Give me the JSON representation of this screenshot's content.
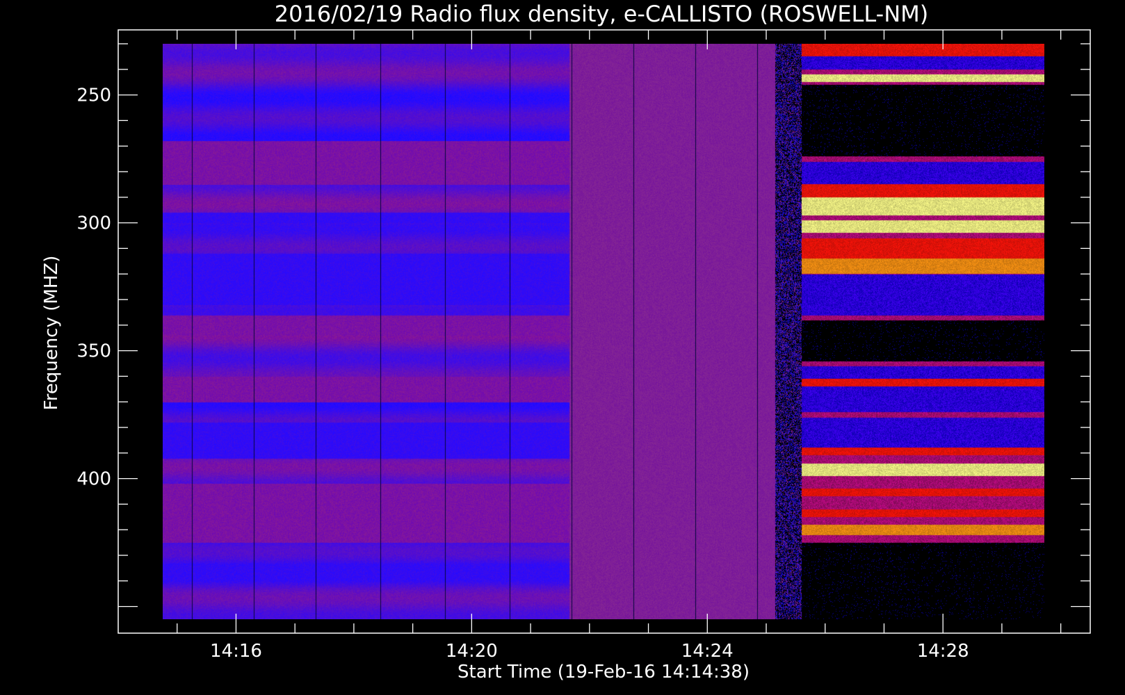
{
  "chart_data": {
    "type": "heatmap",
    "title": "2016/02/19  Radio flux density, e-CALLISTO (ROSWELL-NM)",
    "xlabel": "Start Time (19-Feb-16 14:14:38)",
    "ylabel": "Frequency (MHZ)",
    "x_tick_labels": [
      "14:16",
      "14:20",
      "14:24",
      "14:28"
    ],
    "y_tick_labels": [
      "250",
      "300",
      "350",
      "400"
    ],
    "x_range_minutes": [
      14.0,
      30.5
    ],
    "data_range_minutes": [
      14.75,
      29.72
    ],
    "y_range_mhz": [
      230,
      455
    ],
    "y_axis_inverted": true,
    "colormap": [
      "#000000",
      "#0000ff",
      "#7a2cc2",
      "#ff0000",
      "#ffa500",
      "#ffff66"
    ],
    "segments": [
      {
        "t_start": 14.75,
        "t_end": 21.65,
        "base": "blue-purple"
      },
      {
        "t_start": 21.65,
        "t_end": 25.15,
        "base": "purple"
      },
      {
        "t_start": 25.15,
        "t_end": 25.6,
        "base": "transition"
      },
      {
        "t_start": 25.6,
        "t_end": 29.72,
        "base": "burst"
      }
    ],
    "burst_bands_mhz": [
      {
        "f_start": 230,
        "f_end": 235,
        "level": "red"
      },
      {
        "f_start": 242,
        "f_end": 245,
        "level": "yellow"
      },
      {
        "f_start": 285,
        "f_end": 290,
        "level": "red"
      },
      {
        "f_start": 290,
        "f_end": 297,
        "level": "yellow"
      },
      {
        "f_start": 299,
        "f_end": 304,
        "level": "yellow"
      },
      {
        "f_start": 306,
        "f_end": 314,
        "level": "red"
      },
      {
        "f_start": 314,
        "f_end": 320,
        "level": "orange"
      },
      {
        "f_start": 361,
        "f_end": 364,
        "level": "red"
      },
      {
        "f_start": 388,
        "f_end": 391,
        "level": "red"
      },
      {
        "f_start": 394,
        "f_end": 399,
        "level": "yellow"
      },
      {
        "f_start": 404,
        "f_end": 407,
        "level": "red"
      },
      {
        "f_start": 412,
        "f_end": 415,
        "level": "red"
      },
      {
        "f_start": 418,
        "f_end": 422,
        "level": "orange"
      }
    ]
  }
}
